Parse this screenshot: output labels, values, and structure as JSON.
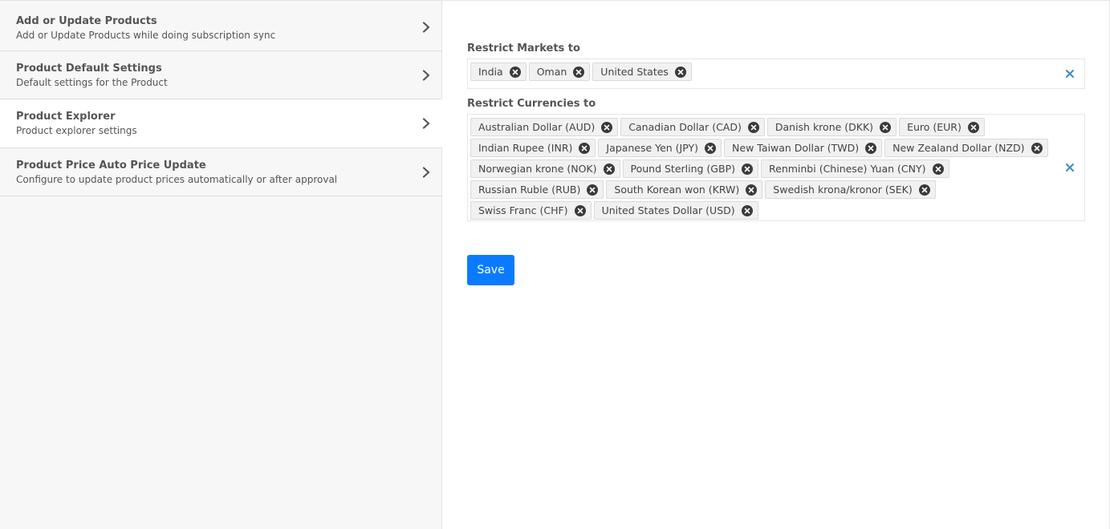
{
  "sidebar": {
    "items": [
      {
        "title": "Add or Update Products",
        "subtitle": "Add or Update Products while doing subscription sync"
      },
      {
        "title": "Product Default Settings",
        "subtitle": "Default settings for the Product"
      },
      {
        "title": "Product Explorer",
        "subtitle": "Product explorer settings"
      },
      {
        "title": "Product Price Auto Price Update",
        "subtitle": "Configure to update product prices automatically or after approval"
      }
    ]
  },
  "main": {
    "markets": {
      "label": "Restrict Markets to",
      "tags": [
        "India",
        "Oman",
        "United States"
      ]
    },
    "currencies": {
      "label": "Restrict Currencies to",
      "tags": [
        "Australian Dollar (AUD)",
        "Canadian Dollar (CAD)",
        "Danish krone (DKK)",
        "Euro (EUR)",
        "Indian Rupee (INR)",
        "Japanese Yen (JPY)",
        "New Taiwan Dollar (TWD)",
        "New Zealand Dollar (NZD)",
        "Norwegian krone (NOK)",
        "Pound Sterling (GBP)",
        "Renminbi (Chinese) Yuan (CNY)",
        "Russian Ruble (RUB)",
        "South Korean won (KRW)",
        "Swedish krona/kronor (SEK)",
        "Swiss Franc (CHF)",
        "United States Dollar (USD)"
      ]
    },
    "save_label": "Save"
  },
  "colors": {
    "primary": "#0a7bff",
    "clear_icon": "#3b8ac4",
    "tag_remove": "#3a3a3a"
  },
  "icons": {
    "sidebar_chevron": "chevron-right-icon",
    "tag_remove": "remove-circle-icon",
    "clear_all": "close-icon"
  }
}
